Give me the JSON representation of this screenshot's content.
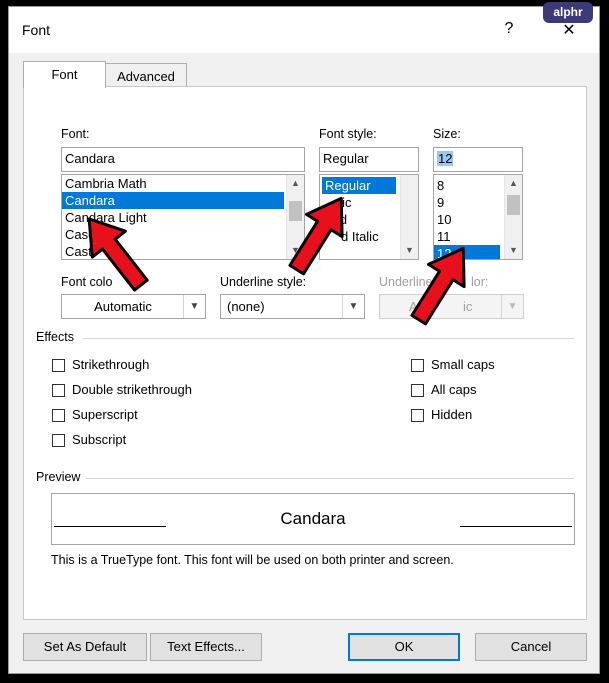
{
  "dialog": {
    "title": "Font",
    "help": "?",
    "close": "✕"
  },
  "watermark": "alphr",
  "tabs": [
    {
      "label": "Font",
      "active": true
    },
    {
      "label": "Advanced",
      "active": false
    }
  ],
  "font": {
    "label": "Font:",
    "value": "Candara",
    "list": [
      "Cambria Math",
      "Candara",
      "Candara Light",
      "Casof",
      "Cast"
    ],
    "selected_index": 1
  },
  "font_style": {
    "label": "Font style:",
    "value": "Regular",
    "list": [
      "Regular",
      "Italic",
      "Bold",
      "Bold Italic"
    ],
    "visible_text": [
      "Regular",
      "alic",
      "ld",
      "d Italic"
    ],
    "selected_index": 0
  },
  "size": {
    "label": "Size:",
    "value": "12",
    "list": [
      "8",
      "9",
      "10",
      "11",
      "12"
    ],
    "selected_index": 4
  },
  "font_color": {
    "label": "Font colo",
    "value": "Automatic"
  },
  "underline_style": {
    "label": "Underline style:",
    "value": "(none)"
  },
  "underline_color": {
    "label": "Underline",
    "label_tail": "lor:",
    "value": "Au",
    "value_tail": "ic"
  },
  "effects": {
    "title": "Effects",
    "left": [
      "Strikethrough",
      "Double strikethrough",
      "Superscript",
      "Subscript"
    ],
    "right": [
      "Small caps",
      "All caps",
      "Hidden"
    ]
  },
  "preview": {
    "title": "Preview",
    "sample": "Candara",
    "note": "This is a TrueType font. This font will be used on both printer and screen."
  },
  "buttons": {
    "set_default": "Set As Default",
    "text_effects": "Text Effects...",
    "ok": "OK",
    "cancel": "Cancel"
  },
  "colors": {
    "selection": "#0078d7",
    "arrow_red": "#e8101a",
    "watermark_bg": "#3d3a7a"
  }
}
